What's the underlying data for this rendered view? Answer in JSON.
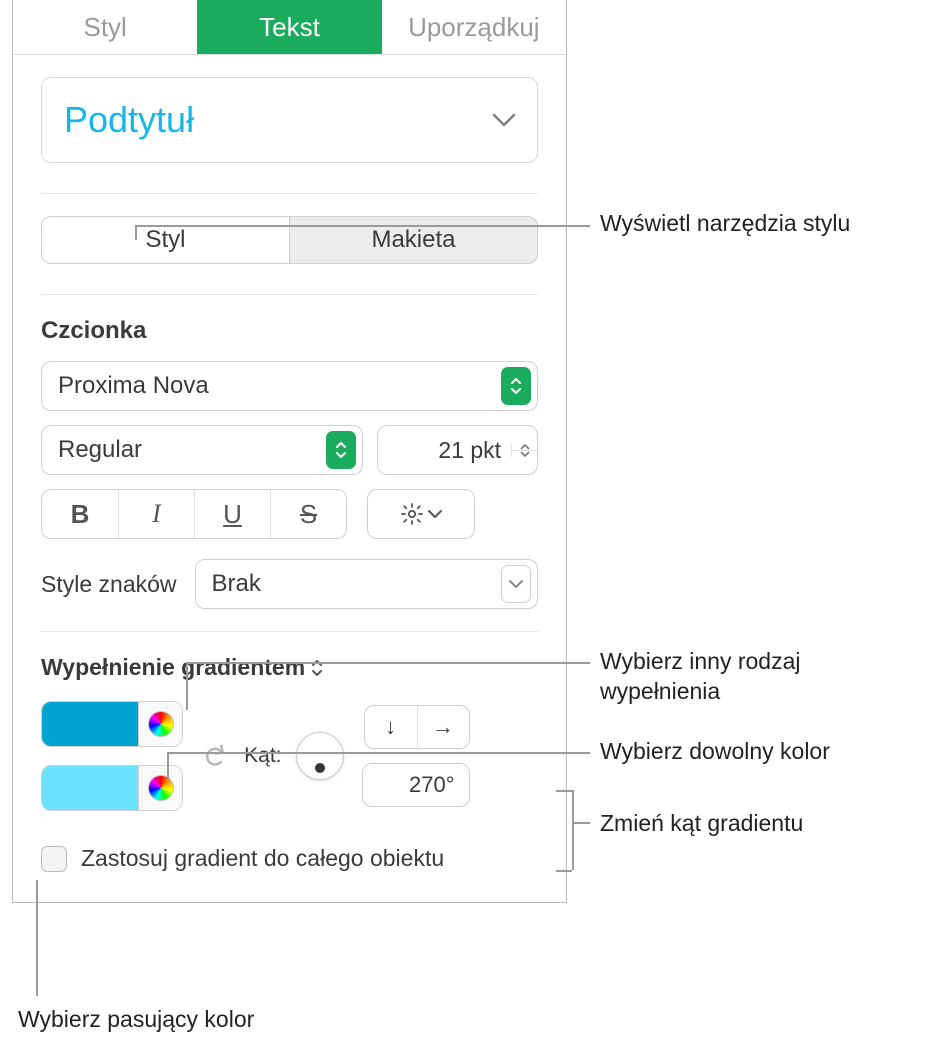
{
  "tabs": {
    "style": "Styl",
    "text": "Tekst",
    "arrange": "Uporządkuj"
  },
  "paragraph_style": "Podtytuł",
  "subtabs": {
    "style": "Styl",
    "layout": "Makieta"
  },
  "font_section": "Czcionka",
  "font_family": "Proxima Nova",
  "font_weight": "Regular",
  "font_size": "21 pkt",
  "char_styles_label": "Style znaków",
  "char_style": "Brak",
  "fill_label": "Wypełnienie gradientem",
  "angle_label": "Kąt:",
  "angle_value": "270°",
  "apply_whole": "Zastosuj gradient do całego obiektu",
  "gradient": {
    "color1": "#00a4cf",
    "color2": "#6be2ff"
  },
  "callouts": {
    "c1": "Wyświetl narzędzia stylu",
    "c2a": "Wybierz inny rodzaj",
    "c2b": "wypełnienia",
    "c3": "Wybierz dowolny kolor",
    "c4": "Zmień kąt gradientu",
    "c5": "Wybierz pasujący kolor"
  }
}
